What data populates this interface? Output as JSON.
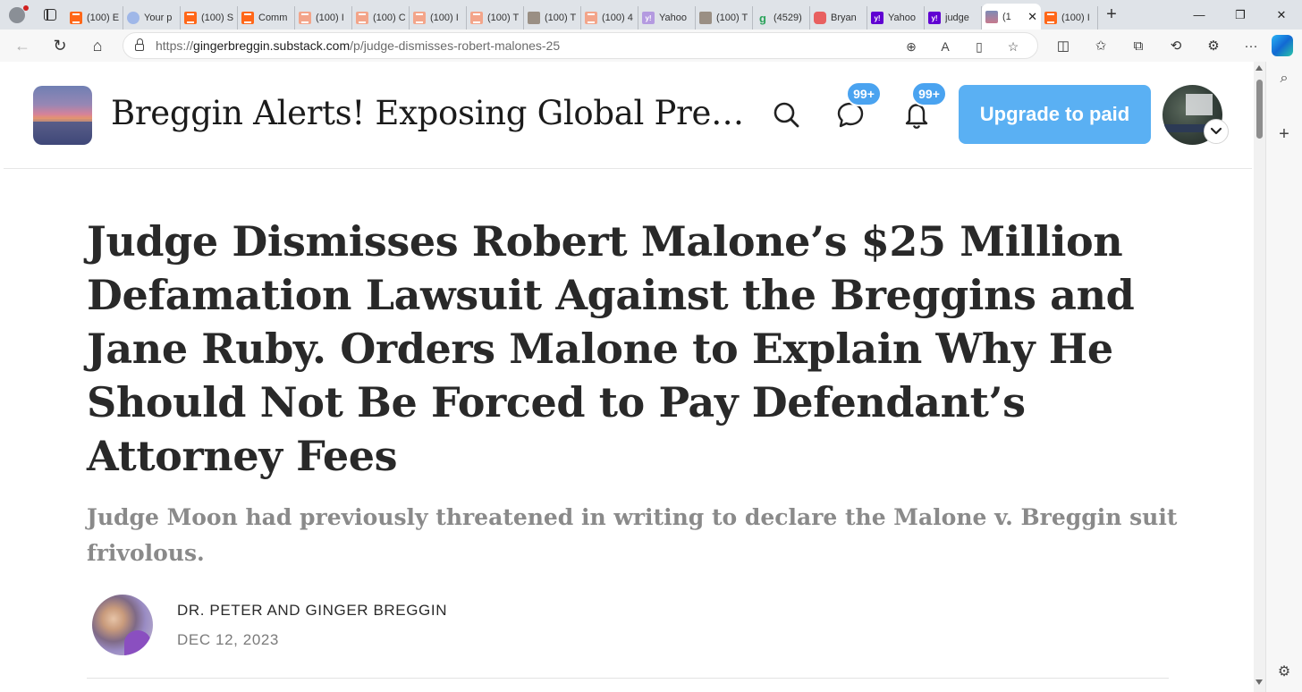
{
  "browser": {
    "tabs": [
      {
        "title": "(100) E",
        "favicon": "substack-icon"
      },
      {
        "title": "Your p",
        "favicon": "copilot-icon"
      },
      {
        "title": "(100) S",
        "favicon": "substack-icon"
      },
      {
        "title": "Comm",
        "favicon": "substack-icon"
      },
      {
        "title": "(100) I",
        "favicon": "substack-pale-icon"
      },
      {
        "title": "(100) C",
        "favicon": "substack-pale-icon"
      },
      {
        "title": "(100) I",
        "favicon": "substack-pale-icon"
      },
      {
        "title": "(100) T",
        "favicon": "substack-pale-icon"
      },
      {
        "title": "(100) T",
        "favicon": "photo-icon"
      },
      {
        "title": "(100) 4",
        "favicon": "substack-pale-icon"
      },
      {
        "title": "Yahoo",
        "favicon": "yahoo-pale-icon"
      },
      {
        "title": "(100) T",
        "favicon": "photo-icon"
      },
      {
        "title": "(4529)",
        "favicon": "g-icon"
      },
      {
        "title": "Bryan",
        "favicon": "youtube-icon"
      },
      {
        "title": "Yahoo",
        "favicon": "yahoo-icon"
      },
      {
        "title": "judge",
        "favicon": "yahoo-icon"
      },
      {
        "title": "(1",
        "favicon": "sunset-icon",
        "active": true
      },
      {
        "title": "(100) I",
        "favicon": "substack-icon"
      }
    ],
    "yahoo_glyph": "y!",
    "g_glyph": "g",
    "url_prefix": "https://",
    "url_host": "gingerbreggin.substack.com",
    "url_path": "/p/judge-dismisses-robert-malones-25"
  },
  "publication": {
    "name": "Breggin Alerts! Exposing Global Pre…",
    "messages_badge": "99+",
    "notifications_badge": "99+",
    "upgrade_label": "Upgrade to paid"
  },
  "post": {
    "title": "Judge Dismisses Robert Malone’s $25 Million Defamation Lawsuit Against the Breggins and Jane Ruby. Orders Malone to Explain Why He Should Not Be Forced to Pay Defendant’s Attorney Fees",
    "subtitle": "Judge Moon had previously threatened in writing to declare the Malone v. Breggin suit frivolous.",
    "author": "Dr. Peter and Ginger Breggin",
    "date": "Dec 12, 2023"
  },
  "colors": {
    "accent": "#5ab0f3",
    "substack_orange": "#ff6719",
    "badge_blue": "#4aa3f0"
  }
}
